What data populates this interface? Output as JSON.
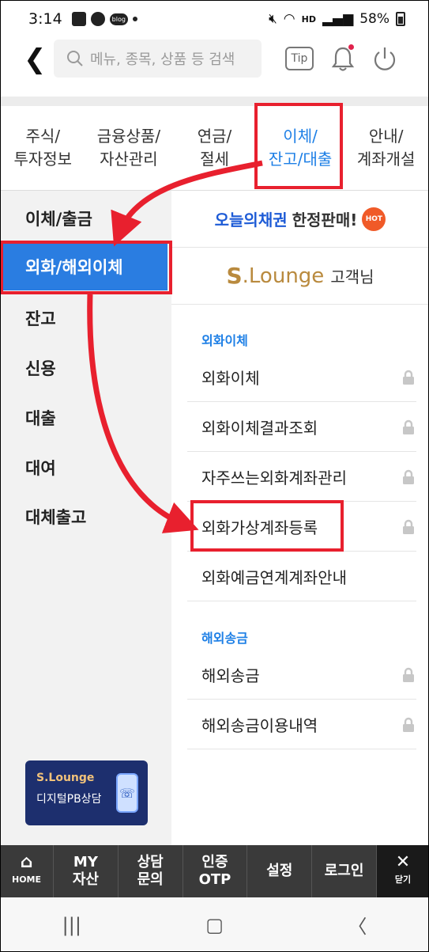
{
  "status": {
    "time": "3:14",
    "hd": "HD",
    "battery": "58%"
  },
  "header": {
    "back": "❮",
    "search_placeholder": "메뉴, 종목, 상품 등 검색",
    "tip": "Tip"
  },
  "tabs": [
    {
      "l1": "주식/",
      "l2": "투자정보"
    },
    {
      "l1": "금융상품/",
      "l2": "자산관리"
    },
    {
      "l1": "연금/",
      "l2": "절세"
    },
    {
      "l1": "이체/",
      "l2": "잔고/대출"
    },
    {
      "l1": "안내/",
      "l2": "계좌개설"
    }
  ],
  "left_menu": [
    "이체/출금",
    "외화/해외이체",
    "잔고",
    "신용",
    "대출",
    "대여",
    "대체출고"
  ],
  "pb_banner": {
    "logo": "S.Lounge",
    "text": "디지털PB상담"
  },
  "promo": {
    "a": "오늘의채권",
    "b": "한정판매!",
    "hot": "HOT"
  },
  "lounge": {
    "s": "S",
    "l": ".Lounge",
    "suffix": "고객님"
  },
  "sections": [
    {
      "title": "외화이체",
      "items": [
        "외화이체",
        "외화이체결과조회",
        "자주쓰는외화계좌관리",
        "외화가상계좌등록",
        "외화예금연계계좌안내"
      ]
    },
    {
      "title": "해외송금",
      "items": [
        "해외송금",
        "해외송금이용내역"
      ]
    }
  ],
  "bottom_bar": {
    "home": "HOME",
    "my_1": "MY",
    "my_2": "자산",
    "consult_1": "상담",
    "consult_2": "문의",
    "otp_1": "인증",
    "otp_2": "OTP",
    "settings": "설정",
    "login": "로그인",
    "close": "닫기"
  }
}
